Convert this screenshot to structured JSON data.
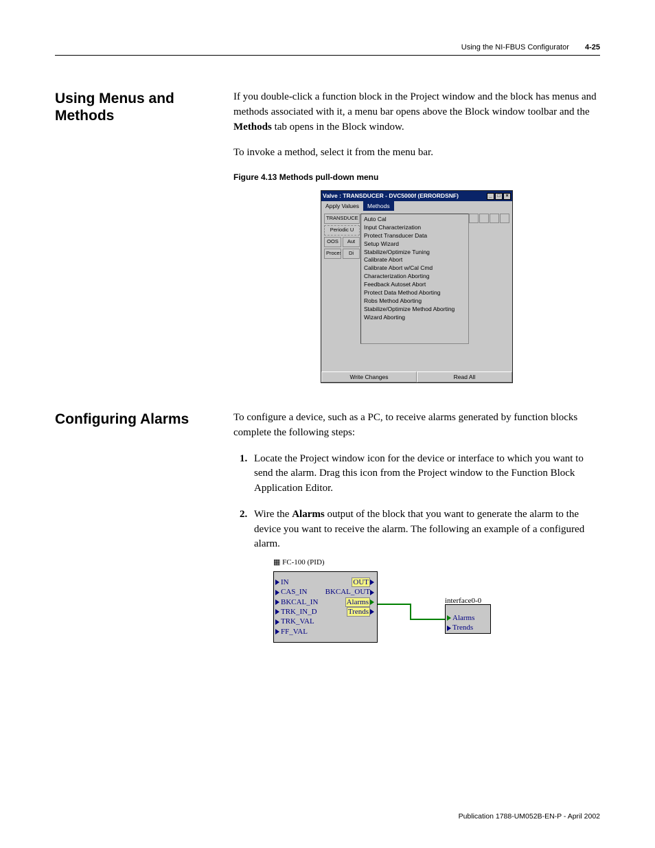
{
  "header": {
    "running_head": "Using the NI-FBUS Configurator",
    "page_number": "4-25"
  },
  "section1": {
    "heading": "Using Menus and Methods",
    "para1_a": "If you double-click a function block in the Project window and the block has menus and methods associated with it, a menu bar opens above the Block window toolbar and the ",
    "para1_bold": "Methods",
    "para1_b": " tab opens in the Block window.",
    "para2": "To invoke a method, select it from the menu bar.",
    "fig_caption": "Figure 4.13 Methods pull-down menu"
  },
  "dialog": {
    "title": "Valve : TRANSDUCER - DVC5000f (ERRORDSNF)",
    "menu": {
      "apply": "Apply Values",
      "methods": "Methods"
    },
    "left_tabs": {
      "transducer": "TRANSDUCE",
      "periodic": "Periodic U",
      "oos": "OOS",
      "aut": "Aut",
      "process": "Process",
      "di": "Di"
    },
    "items": [
      "Auto Cal",
      "Input Characterization",
      "Protect Transducer Data",
      "Setup Wizard",
      "Stabilize/Optimize Tuning",
      "Calibrate Abort",
      "Calibrate Abort w/Cal Cmd",
      "Characterization Aborting",
      "Feedback Autoset Abort",
      "Protect Data Method Aborting",
      "Robs Method Aborting",
      "Stabilize/Optimize Method Aborting",
      "Wizard Aborting"
    ],
    "footer": {
      "write": "Write Changes",
      "read": "Read All"
    }
  },
  "section2": {
    "heading": "Configuring Alarms",
    "intro": "To configure a device, such as a PC, to receive alarms generated by function blocks complete the following steps:",
    "step1": "Locate the Project window icon for the device or interface to which you want to send the alarm. Drag this icon from the Project window to the Function Block Application Editor.",
    "step2_a": "Wire the ",
    "step2_bold": "Alarms",
    "step2_b": " output of the block that you want to generate the alarm to the device you want to receive the alarm. The following an example of a configured alarm."
  },
  "fb": {
    "title": "FC-100 (PID)",
    "in": "IN",
    "out": "OUT",
    "cas_in": "CAS_IN",
    "bkcal_out": "BKCAL_OUT",
    "bkcal_in": "BKCAL_IN",
    "alarms": "Alarms",
    "trk_in_d": "TRK_IN_D",
    "trends": "Trends",
    "trk_val": "TRK_VAL",
    "ff_val": "FF_VAL",
    "iface": "interface0-0",
    "if_alarms": "Alarms",
    "if_trends": "Trends"
  },
  "footer": "Publication 1788-UM052B-EN-P - April 2002"
}
